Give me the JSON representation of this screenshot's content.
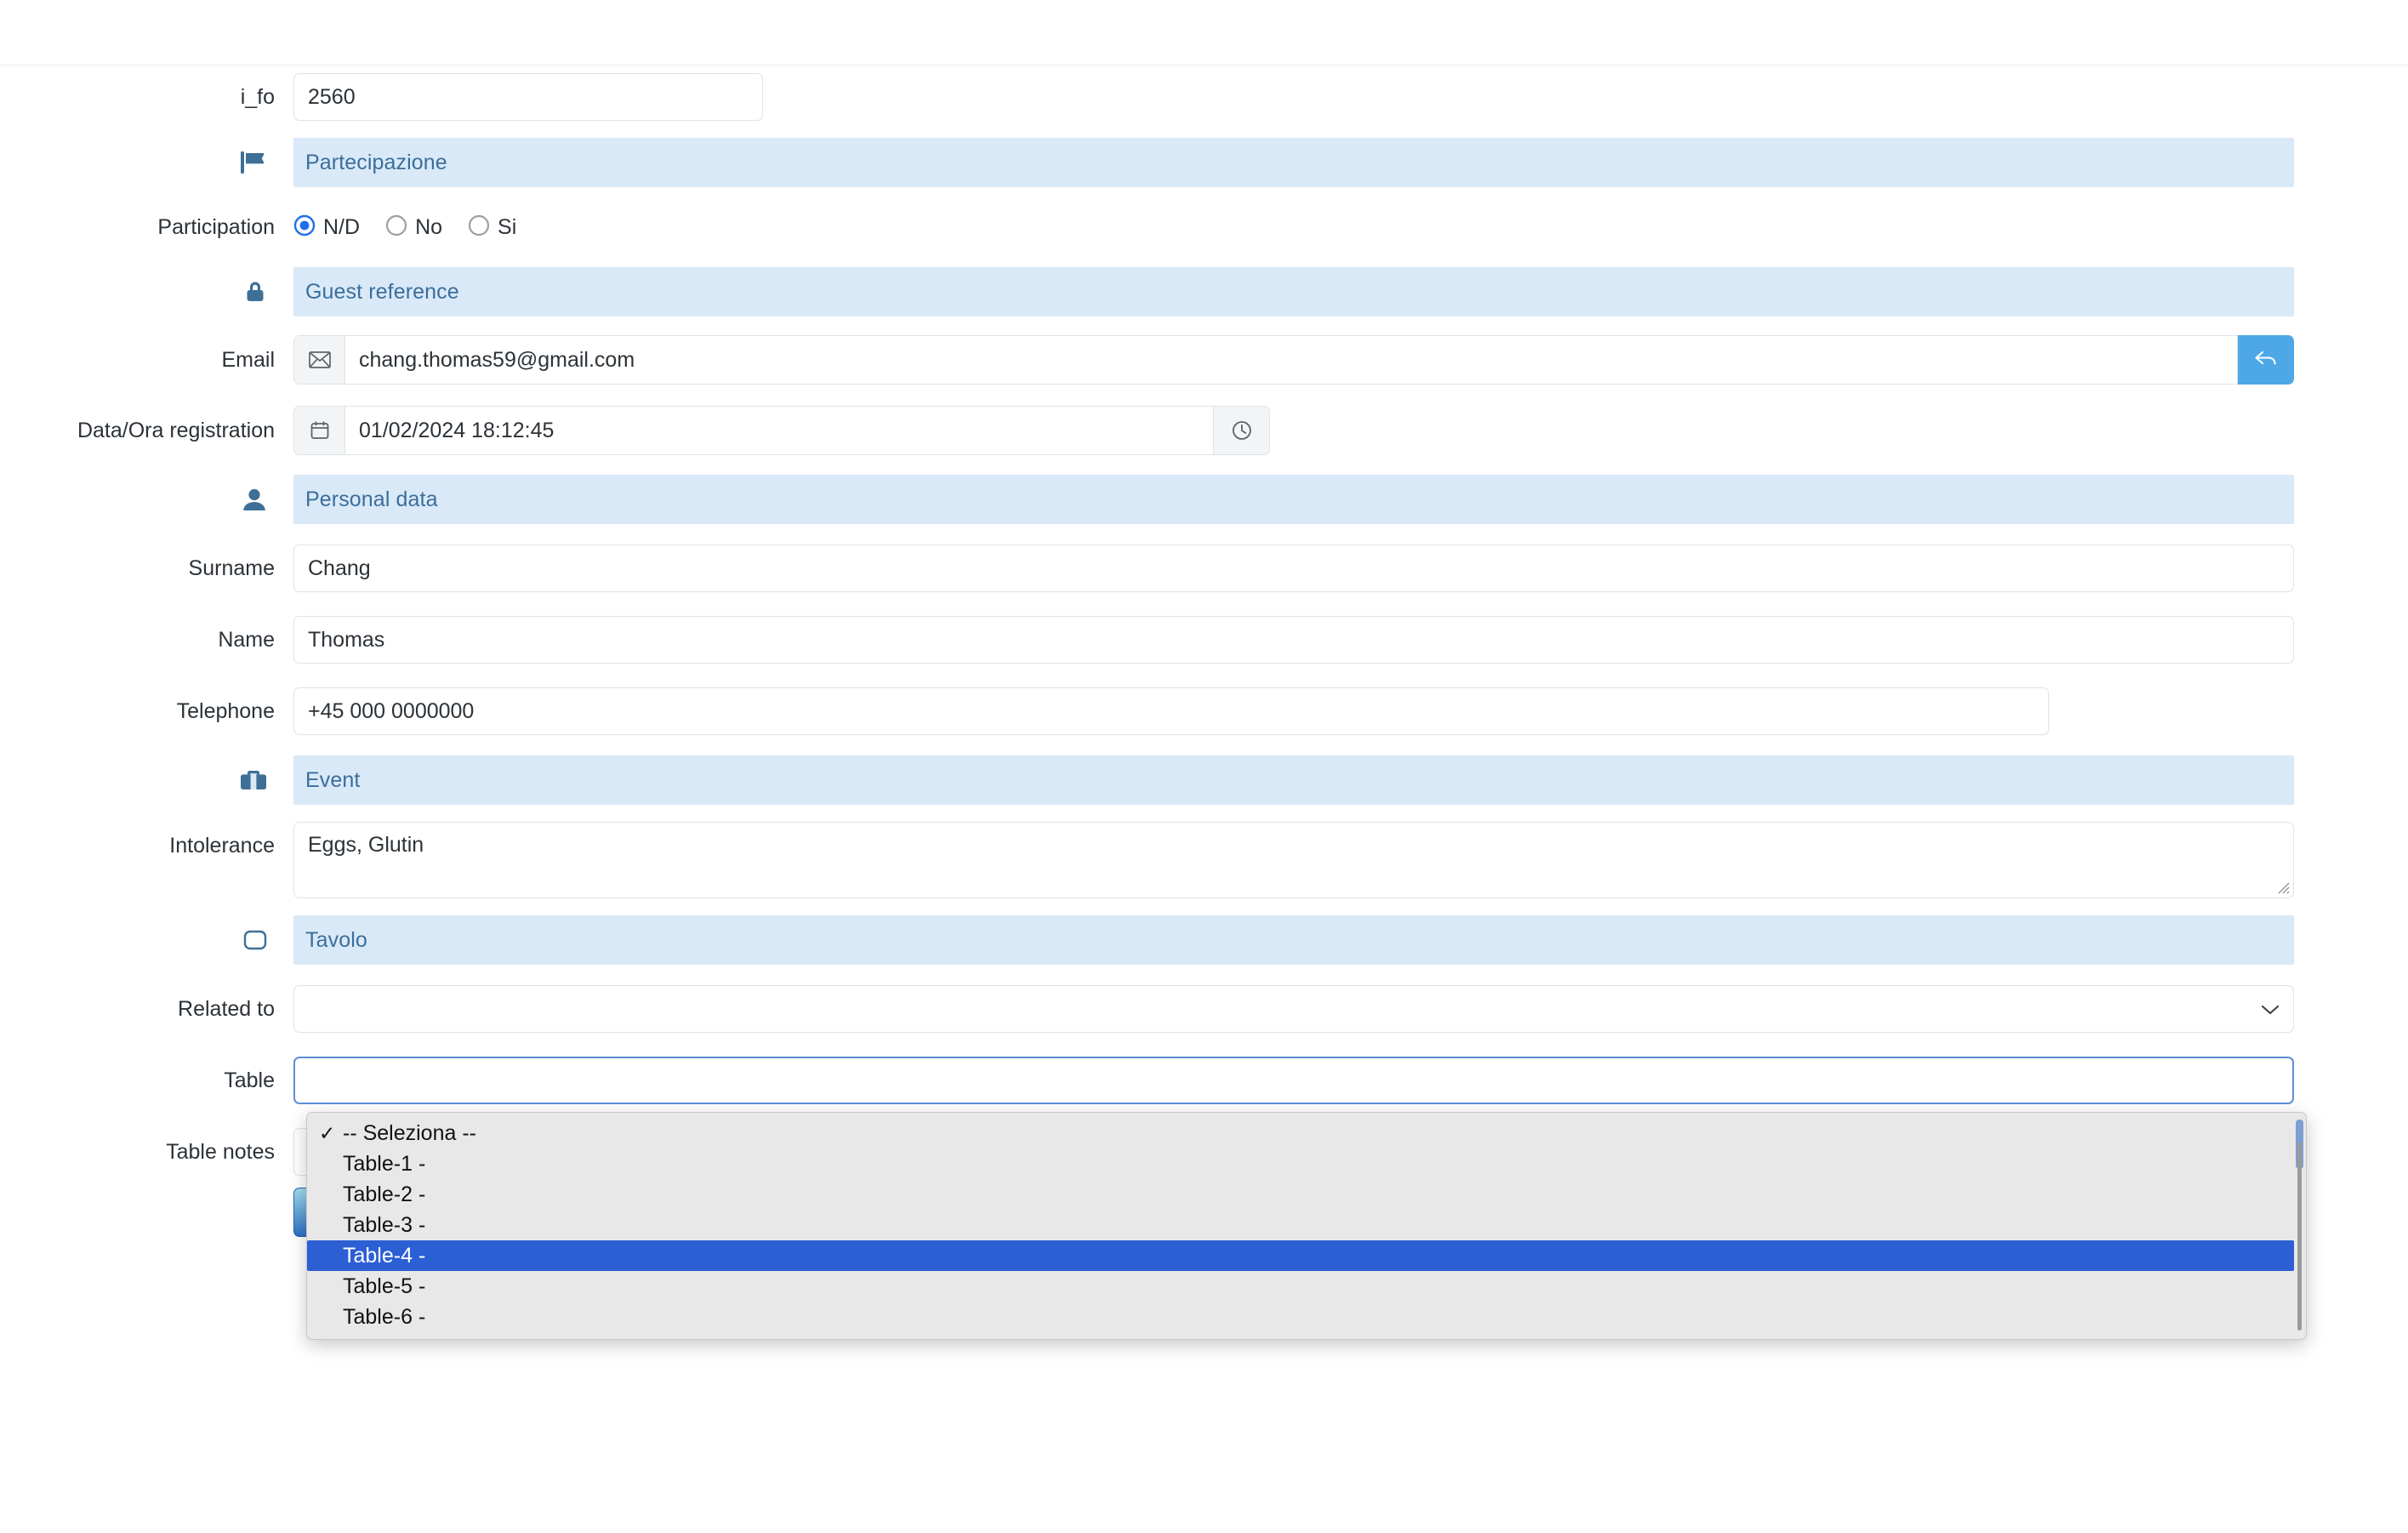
{
  "form": {
    "id_field": {
      "label": "i_fo",
      "value": "2560"
    },
    "sections": {
      "participation": {
        "title": "Partecipazione",
        "icon": "flag-icon"
      },
      "guest_reference": {
        "title": "Guest reference",
        "icon": "lock-icon"
      },
      "personal_data": {
        "title": "Personal data",
        "icon": "person-icon"
      },
      "event": {
        "title": "Event",
        "icon": "briefcase-icon"
      },
      "tavolo": {
        "title": "Tavolo",
        "icon": "table-icon"
      }
    },
    "participation": {
      "label": "Participation",
      "options": [
        {
          "label": "N/D",
          "selected": true
        },
        {
          "label": "No",
          "selected": false
        },
        {
          "label": "Si",
          "selected": false
        }
      ]
    },
    "email": {
      "label": "Email",
      "value": "chang.thomas59@gmail.com",
      "prefix_icon": "envelope-icon",
      "action_icon": "reply-arrow-icon"
    },
    "registration": {
      "label": "Data/Ora registration",
      "value": "01/02/2024 18:12:45",
      "prefix_icon": "calendar-icon",
      "suffix_icon": "clock-icon"
    },
    "surname": {
      "label": "Surname",
      "value": "Chang"
    },
    "name": {
      "label": "Name",
      "value": "Thomas"
    },
    "telephone": {
      "label": "Telephone",
      "value": "+45 000 0000000"
    },
    "intolerance": {
      "label": "Intolerance",
      "value": "Eggs, Glutin"
    },
    "related_to": {
      "label": "Related to",
      "value": "",
      "chevron": "chevron-down-icon"
    },
    "table": {
      "label": "Table",
      "value": ""
    },
    "table_notes": {
      "label": "Table notes",
      "value": ""
    }
  },
  "dropdown": {
    "options": [
      {
        "label": "-- Seleziona --",
        "checked": true,
        "highlighted": false
      },
      {
        "label": "Table-1 -",
        "checked": false,
        "highlighted": false
      },
      {
        "label": "Table-2 -",
        "checked": false,
        "highlighted": false
      },
      {
        "label": "Table-3 -",
        "checked": false,
        "highlighted": false
      },
      {
        "label": "Table-4 -",
        "checked": false,
        "highlighted": true
      },
      {
        "label": "Table-5 -",
        "checked": false,
        "highlighted": false
      },
      {
        "label": "Table-6 -",
        "checked": false,
        "highlighted": false
      }
    ],
    "check_glyph": "✓"
  },
  "colors": {
    "section_band": "#d9e9f7",
    "section_text": "#3b6e9c",
    "section_icon": "#3e7097",
    "accent_blue": "#4ea8e8",
    "radio_selected": "#1f6fe8",
    "dropdown_highlight": "#2c5fd4",
    "dropdown_background": "#e8e8e8",
    "input_border": "#dfe3e8",
    "text": "#2c3237"
  }
}
